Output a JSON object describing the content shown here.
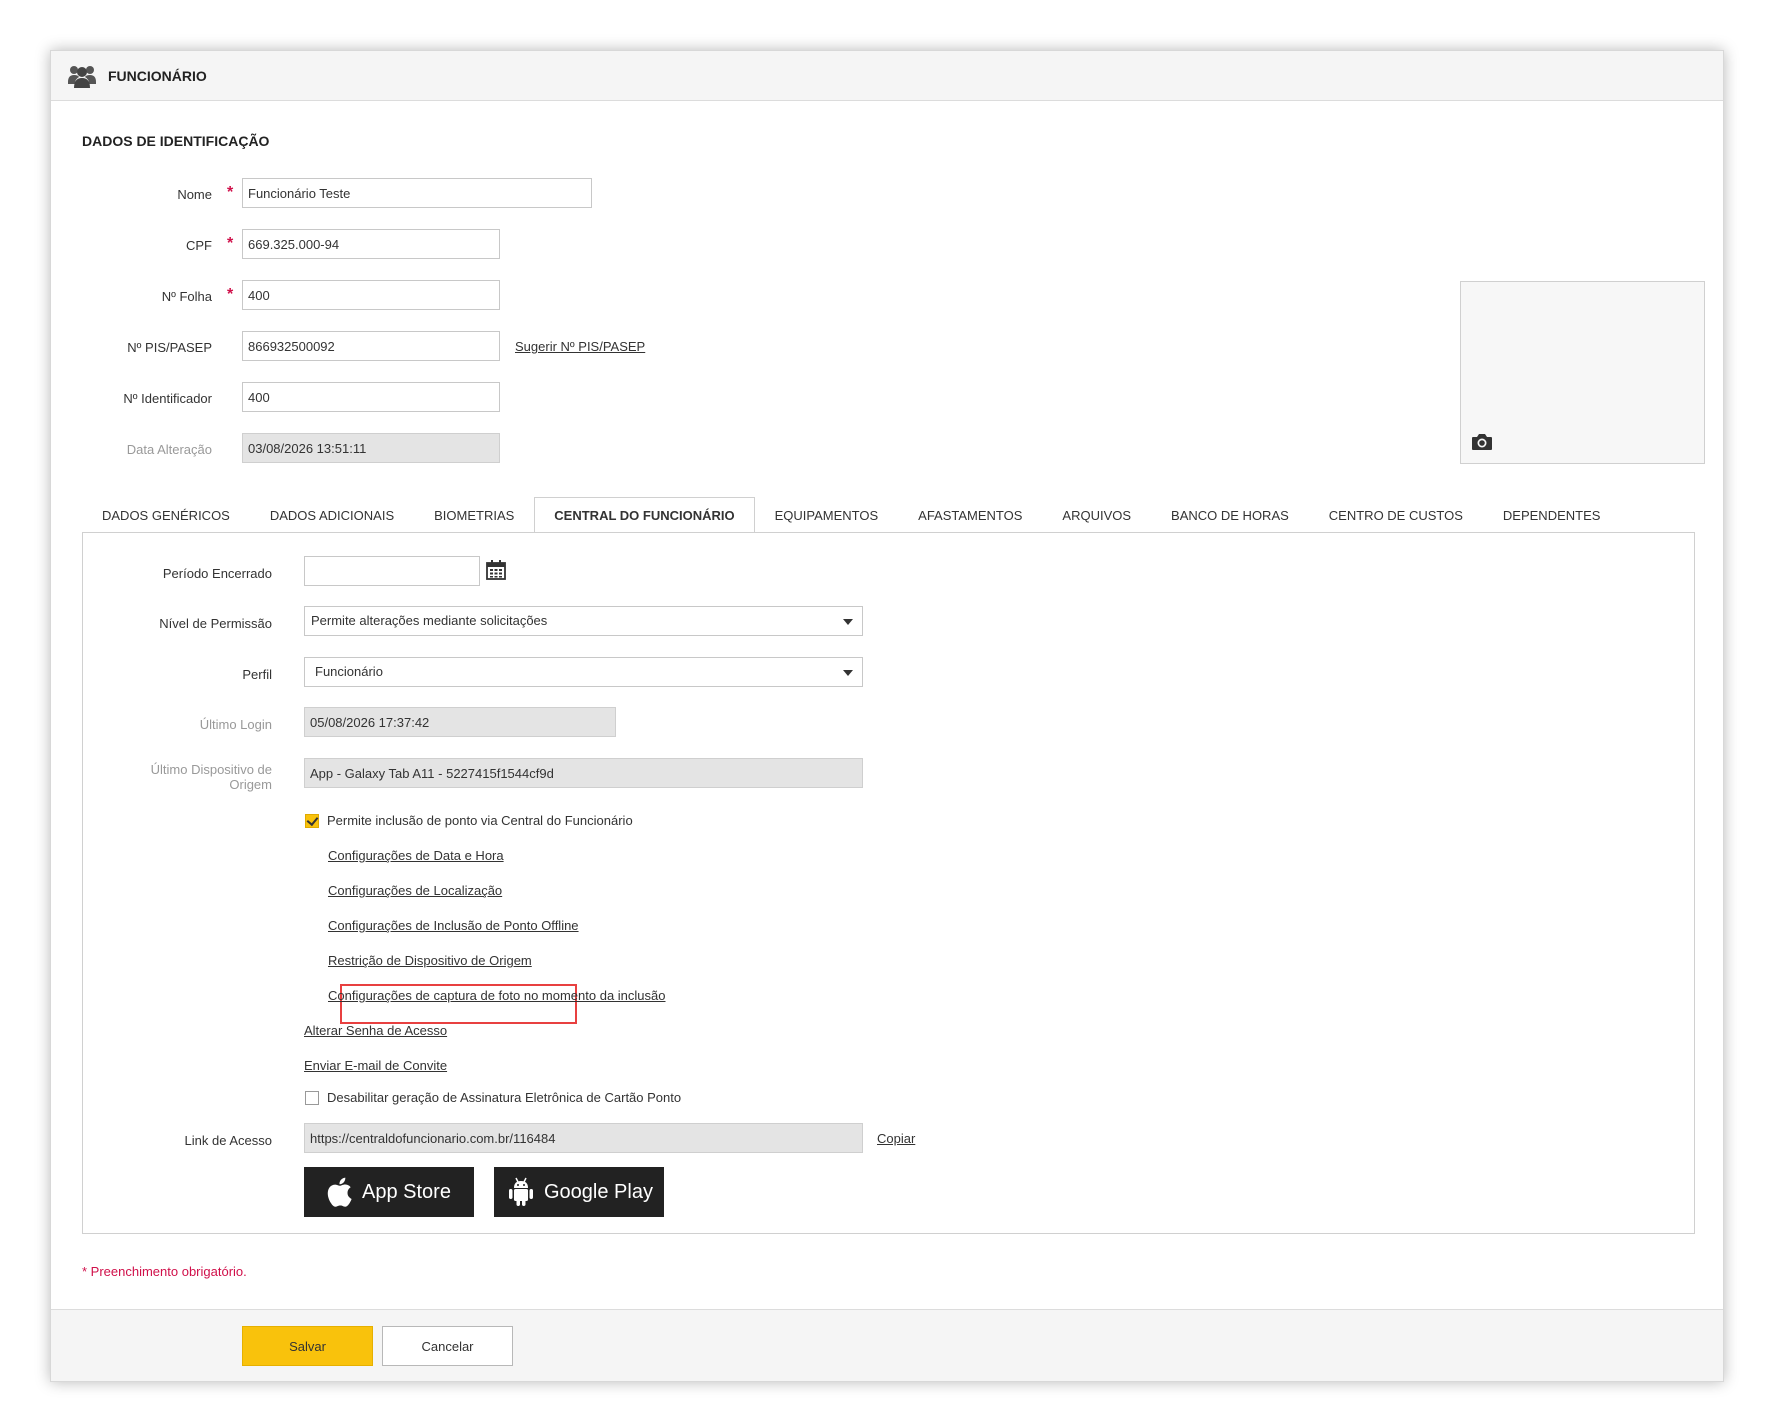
{
  "header": {
    "title": "FUNCIONÁRIO",
    "icon": "users-icon"
  },
  "section": {
    "title": "DADOS DE IDENTIFICAÇÃO"
  },
  "identification": {
    "nome": {
      "label": "Nome",
      "value": "Funcionário Teste"
    },
    "cpf": {
      "label": "CPF",
      "value": "669.325.000-94"
    },
    "folha": {
      "label": "Nº Folha",
      "value": "400"
    },
    "pis": {
      "label": "Nº PIS/PASEP",
      "value": "866932500092",
      "suggest_link": "Sugerir Nº PIS/PASEP"
    },
    "identificador": {
      "label": "Nº Identificador",
      "value": "400"
    },
    "data_alteracao": {
      "label": "Data Alteração",
      "value": "03/08/2026 13:51:11"
    },
    "required_mark": "*"
  },
  "photo": {
    "icon": "camera-icon"
  },
  "tabs": [
    {
      "label": "DADOS GENÉRICOS"
    },
    {
      "label": "DADOS ADICIONAIS"
    },
    {
      "label": "BIOMETRIAS"
    },
    {
      "label": "CENTRAL DO FUNCIONÁRIO",
      "active": true
    },
    {
      "label": "EQUIPAMENTOS"
    },
    {
      "label": "AFASTAMENTOS"
    },
    {
      "label": "ARQUIVOS"
    },
    {
      "label": "BANCO DE HORAS"
    },
    {
      "label": "CENTRO DE CUSTOS"
    },
    {
      "label": "DEPENDENTES"
    }
  ],
  "central": {
    "periodo": {
      "label": "Período Encerrado",
      "value": ""
    },
    "nivel": {
      "label": "Nível de Permissão",
      "value": "Permite alterações mediante solicitações"
    },
    "perfil": {
      "label": "Perfil",
      "value": "Funcionário"
    },
    "ultimo_login": {
      "label": "Último Login",
      "value": "05/08/2026 17:37:42"
    },
    "ultimo_dispositivo": {
      "label_line1": "Último Dispositivo de",
      "label_line2": "Origem",
      "value": "App - Galaxy Tab A11 - 5227415f1544cf9d"
    },
    "permite_ponto": {
      "label": "Permite inclusão de ponto via Central do Funcionário",
      "checked": true
    },
    "links": {
      "data_hora": "Configurações de Data e Hora",
      "localizacao": "Configurações de Localização",
      "offline": "Configurações de Inclusão de Ponto Offline",
      "restricao": "Restrição de Dispositivo de Origem",
      "captura_foto": "Configurações de captura de foto no momento da inclusão",
      "alterar_senha": "Alterar Senha de Acesso",
      "enviar_email": "Enviar E-mail de Convite"
    },
    "desabilitar_assinatura": {
      "label": "Desabilitar geração de Assinatura Eletrônica de Cartão Ponto",
      "checked": false
    },
    "link_acesso": {
      "label": "Link de Acesso",
      "value": "https://centraldofuncionario.com.br/116484",
      "copy_label": "Copiar"
    },
    "app_store": {
      "label": "App Store",
      "icon": "apple-icon"
    },
    "google_play": {
      "label": "Google Play",
      "icon": "android-icon"
    }
  },
  "required_note": "* Preenchimento obrigatório.",
  "footer": {
    "save": "Salvar",
    "cancel": "Cancelar"
  },
  "colors": {
    "accent": "#f9c20c",
    "required": "#d0104a",
    "highlight": "#e84040"
  }
}
